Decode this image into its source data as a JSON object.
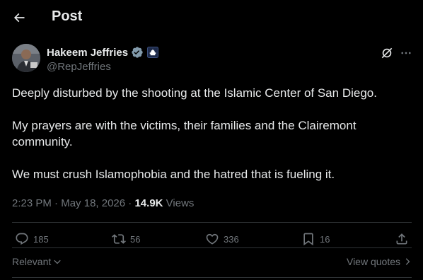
{
  "header": {
    "title": "Post",
    "back_icon": "arrow-left-icon"
  },
  "author": {
    "display_name": "Hakeem Jeffries",
    "handle": "@RepJeffries",
    "verified_color": "#829aab",
    "affiliation_badge": "capitol-dome-icon"
  },
  "post": {
    "paragraphs": [
      "Deeply disturbed by the shooting at the Islamic Center of San Diego.",
      "My prayers are with the victims, their families and the Clairemont community.",
      "We must crush Islamophobia and the hatred that is fueling it."
    ],
    "time": "2:23 PM",
    "separator": "·",
    "date": "May 18, 2026",
    "views_count": "14.9K",
    "views_label": "Views"
  },
  "actions": {
    "replies": "185",
    "reposts": "56",
    "likes": "336",
    "bookmarks": "16"
  },
  "footer": {
    "sort_label": "Relevant",
    "view_quotes_label": "View quotes"
  },
  "colors": {
    "background": "#000000",
    "text": "#e7e9ea",
    "secondary": "#71767b",
    "divider": "#2f3336"
  }
}
